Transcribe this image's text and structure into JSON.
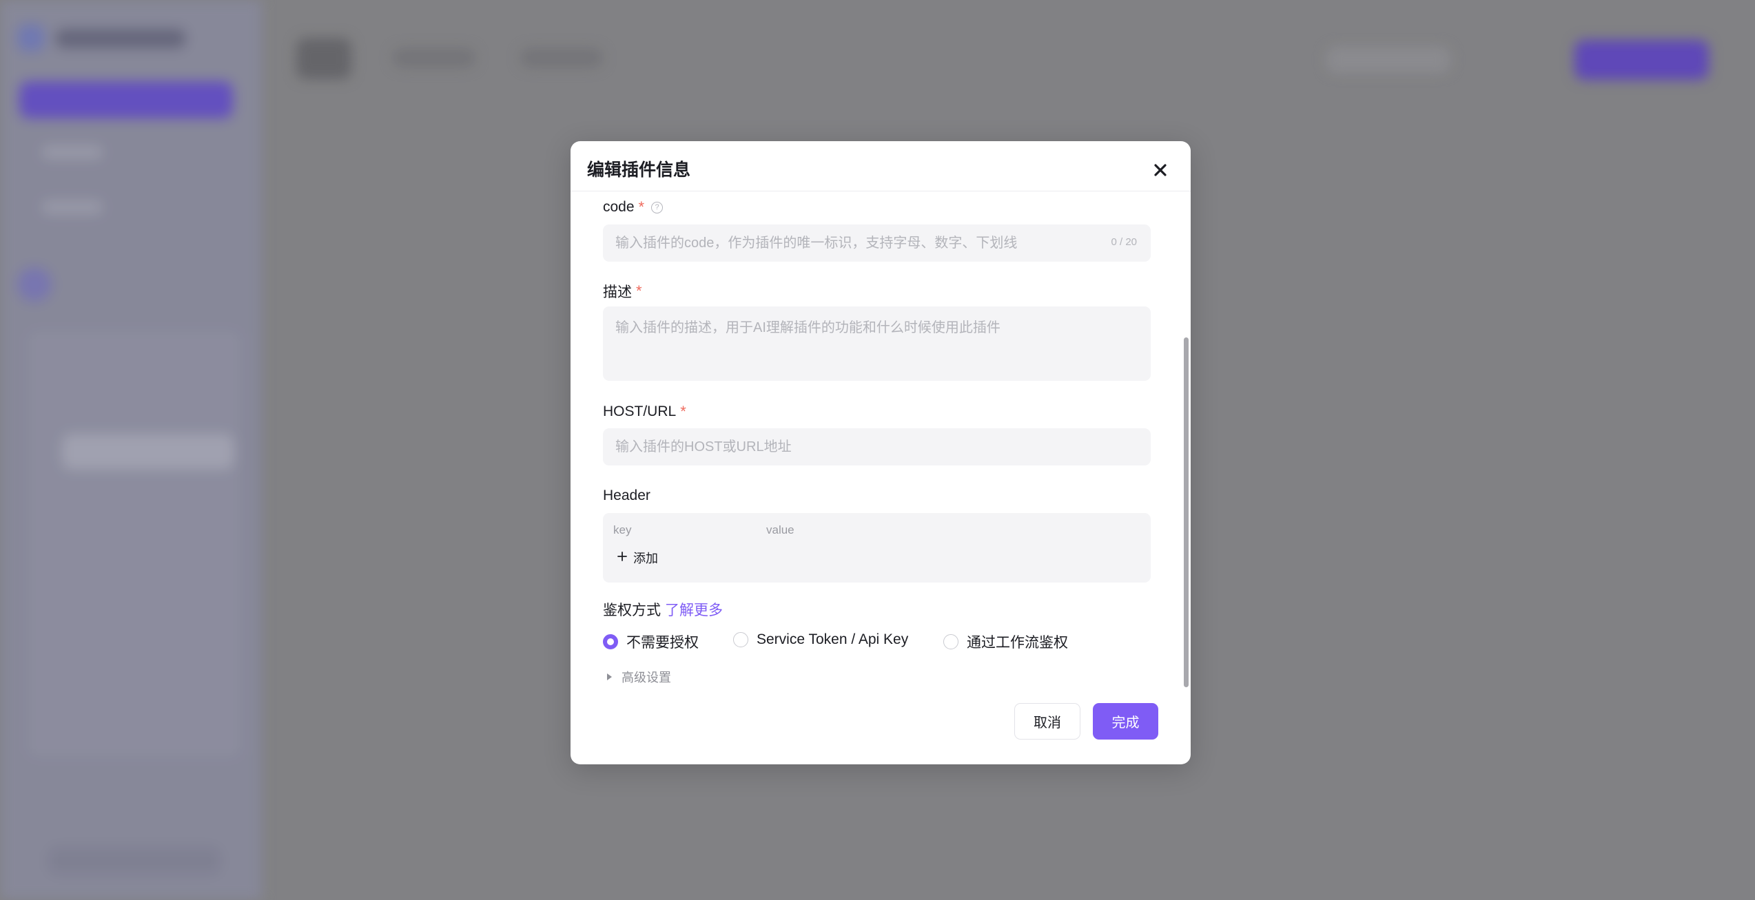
{
  "modal": {
    "title": "编辑插件信息",
    "code": {
      "label": "code",
      "required_mark": "*",
      "placeholder": "输入插件的code，作为插件的唯一标识，支持字母、数字、下划线",
      "counter": "0 / 20"
    },
    "description": {
      "label": "描述",
      "required_mark": "*",
      "placeholder": "输入插件的描述，用于AI理解插件的功能和什么时候使用此插件"
    },
    "host": {
      "label": "HOST/URL",
      "required_mark": "*",
      "placeholder": "输入插件的HOST或URL地址"
    },
    "header": {
      "label": "Header",
      "key_col": "key",
      "value_col": "value",
      "add_label": "添加"
    },
    "auth": {
      "label": "鉴权方式",
      "link": "了解更多",
      "selected": "不需要授权",
      "options": [
        "不需要授权",
        "Service Token / Api Key",
        "通过工作流鉴权"
      ]
    },
    "advanced_label": "高级设置",
    "cancel_label": "取消",
    "ok_label": "完成"
  },
  "colors": {
    "accent": "#7f5cf5",
    "required": "#ef6b5e",
    "field_bg": "#f4f4f6"
  }
}
